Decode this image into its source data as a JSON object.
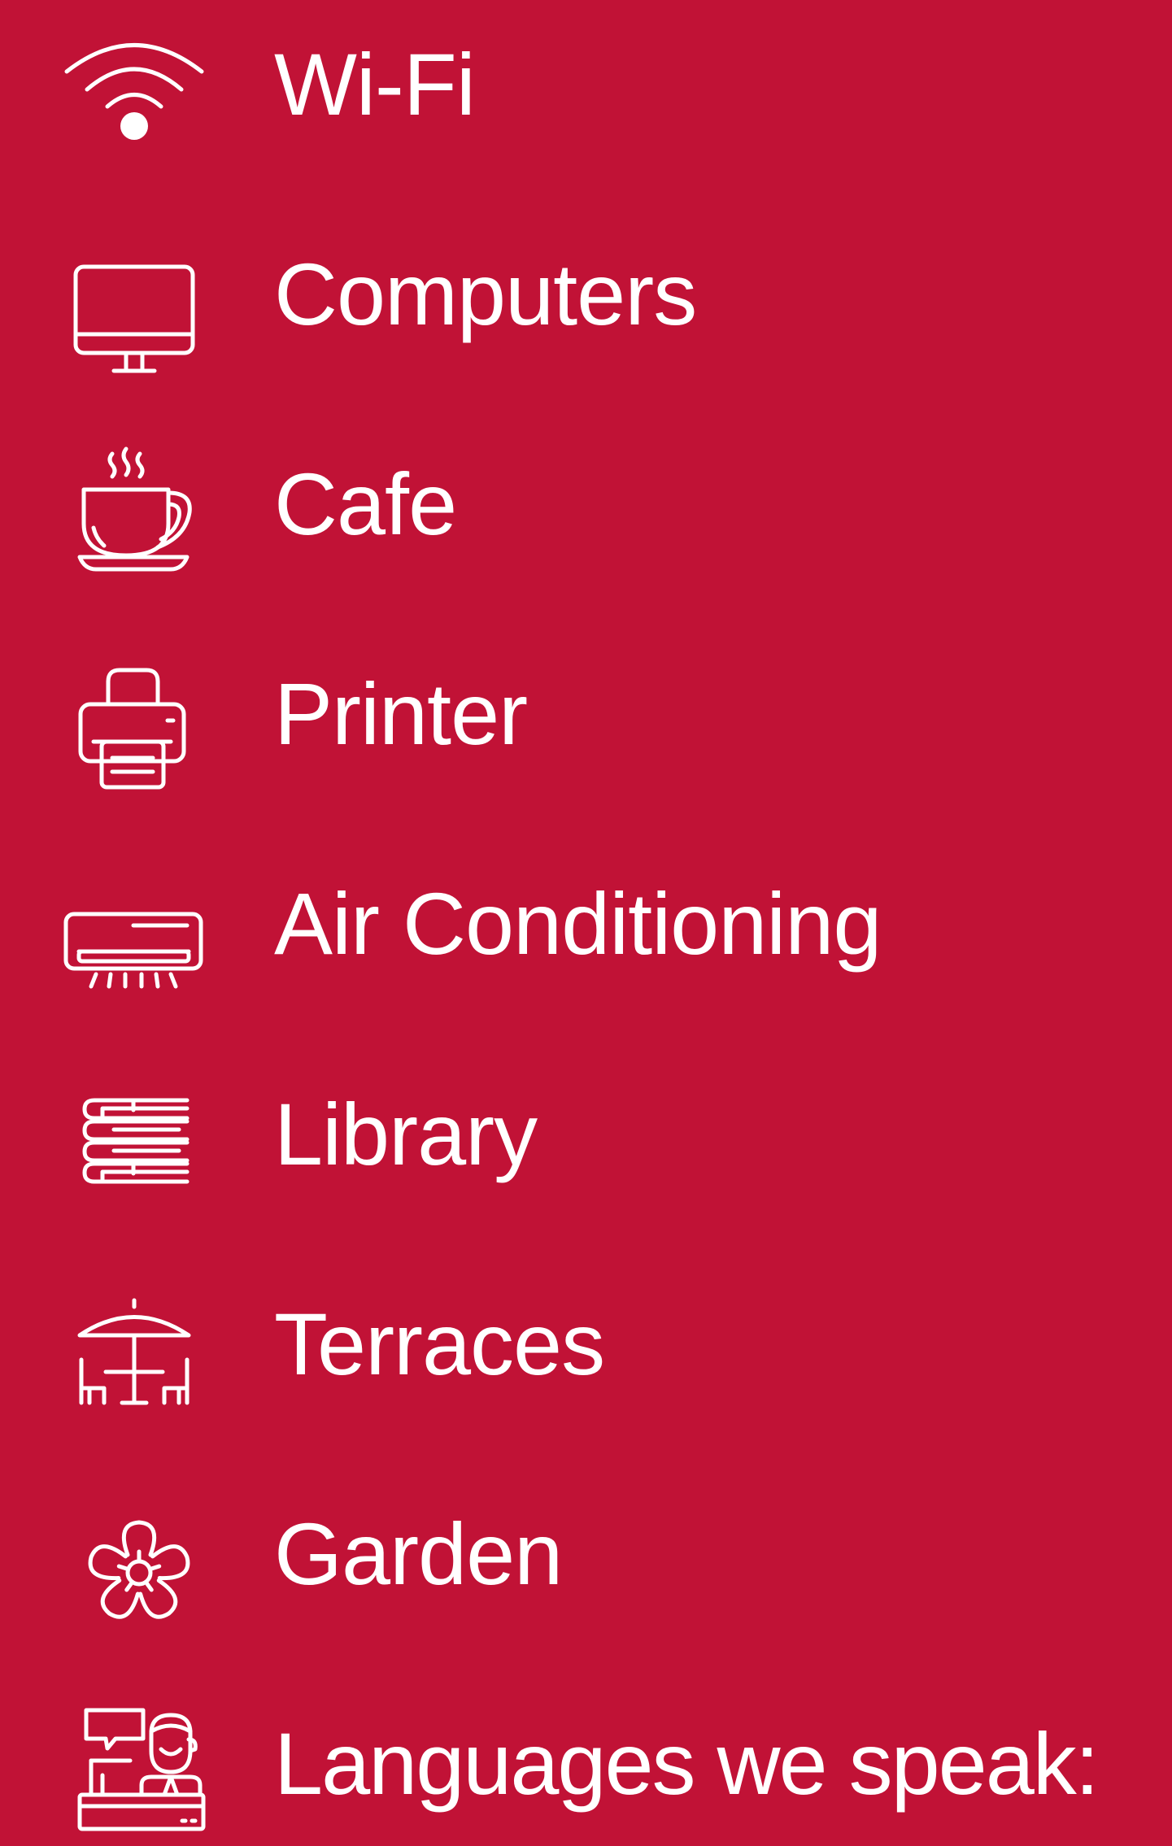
{
  "theme": {
    "background": "#c11236",
    "foreground": "#ffffff"
  },
  "amenities": [
    {
      "label": "Wi-Fi",
      "icon": "wifi-icon"
    },
    {
      "label": "Computers",
      "icon": "monitor-icon"
    },
    {
      "label": "Cafe",
      "icon": "coffee-cup-icon"
    },
    {
      "label": "Printer",
      "icon": "printer-icon"
    },
    {
      "label": "Air Conditioning",
      "icon": "air-conditioner-icon"
    },
    {
      "label": "Library",
      "icon": "books-icon"
    },
    {
      "label": "Terraces",
      "icon": "terrace-table-umbrella-icon"
    },
    {
      "label": "Garden",
      "icon": "flower-icon"
    },
    {
      "label": "Languages we speak:",
      "icon": "reception-desk-speech-icon"
    }
  ]
}
